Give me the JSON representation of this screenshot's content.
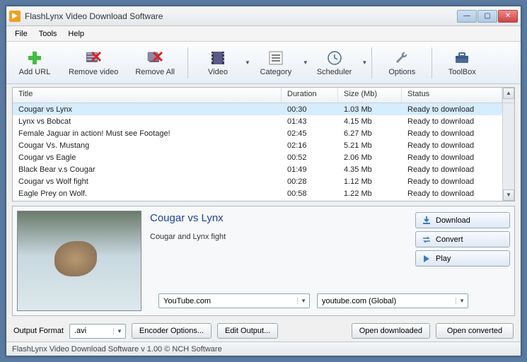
{
  "window": {
    "title": "FlashLynx Video Download Software"
  },
  "menu": {
    "file": "File",
    "tools": "Tools",
    "help": "Help"
  },
  "toolbar": {
    "add_url": "Add URL",
    "remove_video": "Remove video",
    "remove_all": "Remove All",
    "video": "Video",
    "category": "Category",
    "scheduler": "Scheduler",
    "options": "Options",
    "toolbox": "ToolBox"
  },
  "columns": {
    "title": "Title",
    "duration": "Duration",
    "size": "Size (Mb)",
    "status": "Status"
  },
  "rows": [
    {
      "title": "Cougar vs Lynx",
      "duration": "00:30",
      "size": "1.03 Mb",
      "status": "Ready to download",
      "selected": true
    },
    {
      "title": "Lynx vs Bobcat",
      "duration": "01:43",
      "size": "4.15 Mb",
      "status": "Ready to download"
    },
    {
      "title": "Female Jaguar in action! Must see Footage!",
      "duration": "02:45",
      "size": "6.27 Mb",
      "status": "Ready to download"
    },
    {
      "title": "Cougar Vs. Mustang",
      "duration": "02:16",
      "size": "5.21 Mb",
      "status": "Ready to download"
    },
    {
      "title": "Cougar vs Eagle",
      "duration": "00:52",
      "size": "2.06 Mb",
      "status": "Ready to download"
    },
    {
      "title": "Black Bear v.s Cougar",
      "duration": "01:49",
      "size": "4.35 Mb",
      "status": "Ready to download"
    },
    {
      "title": "Cougar vs Wolf fight",
      "duration": "00:28",
      "size": "1.12 Mb",
      "status": "Ready to download"
    },
    {
      "title": "Eagle Prey on Wolf.",
      "duration": "00:58",
      "size": "1.22 Mb",
      "status": "Ready to download"
    }
  ],
  "details": {
    "title": "Cougar vs Lynx",
    "description": "Cougar and Lynx fight",
    "download": "Download",
    "convert": "Convert",
    "play": "Play",
    "source_site": "YouTube.com",
    "region": "youtube.com (Global)"
  },
  "bottom": {
    "output_format_label": "Output Format",
    "output_format": ".avi",
    "encoder_options": "Encoder Options...",
    "edit_output": "Edit Output...",
    "open_downloaded": "Open downloaded",
    "open_converted": "Open converted"
  },
  "statusbar": "FlashLynx Video Download Software v 1.00 © NCH Software"
}
